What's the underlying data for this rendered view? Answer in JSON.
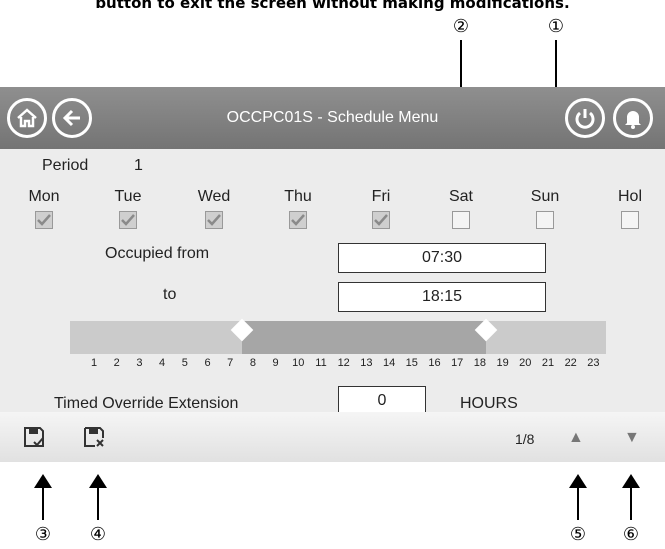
{
  "caption": "button to exit the screen without making modifications.",
  "callouts": [
    "②",
    "①",
    "③",
    "④",
    "⑤",
    "⑥"
  ],
  "header": {
    "title": "OCCPC01S - Schedule Menu",
    "home_icon": "home-icon",
    "back_icon": "arrow-left-icon",
    "power_icon": "power-icon",
    "bell_icon": "bell-icon"
  },
  "period": {
    "label": "Period",
    "value": "1"
  },
  "days": [
    {
      "label": "Mon",
      "checked": true
    },
    {
      "label": "Tue",
      "checked": true
    },
    {
      "label": "Wed",
      "checked": true
    },
    {
      "label": "Thu",
      "checked": true
    },
    {
      "label": "Fri",
      "checked": true
    },
    {
      "label": "Sat",
      "checked": false
    },
    {
      "label": "Sun",
      "checked": false
    },
    {
      "label": "Hol",
      "checked": false
    }
  ],
  "occupied": {
    "from_label": "Occupied from",
    "from_value": "07:30",
    "to_label": "to",
    "to_value": "18:15"
  },
  "timeline": {
    "ticks": [
      "1",
      "2",
      "3",
      "4",
      "5",
      "6",
      "7",
      "8",
      "9",
      "10",
      "11",
      "12",
      "13",
      "14",
      "15",
      "16",
      "17",
      "18",
      "19",
      "20",
      "21",
      "22",
      "23"
    ],
    "start_hour": 7.5,
    "end_hour": 18.25
  },
  "override": {
    "label": "Timed Override Extension",
    "value": "0",
    "unit": "HOURS"
  },
  "footer": {
    "page": "1/8",
    "save_icon": "save-icon",
    "discard_icon": "discard-save-icon",
    "up_glyph": "▲",
    "down_glyph": "▼"
  },
  "colors": {
    "header": "#808080",
    "content": "#ececec",
    "bar": "#cbcbcb",
    "bar_fill": "#a6a6a6"
  }
}
